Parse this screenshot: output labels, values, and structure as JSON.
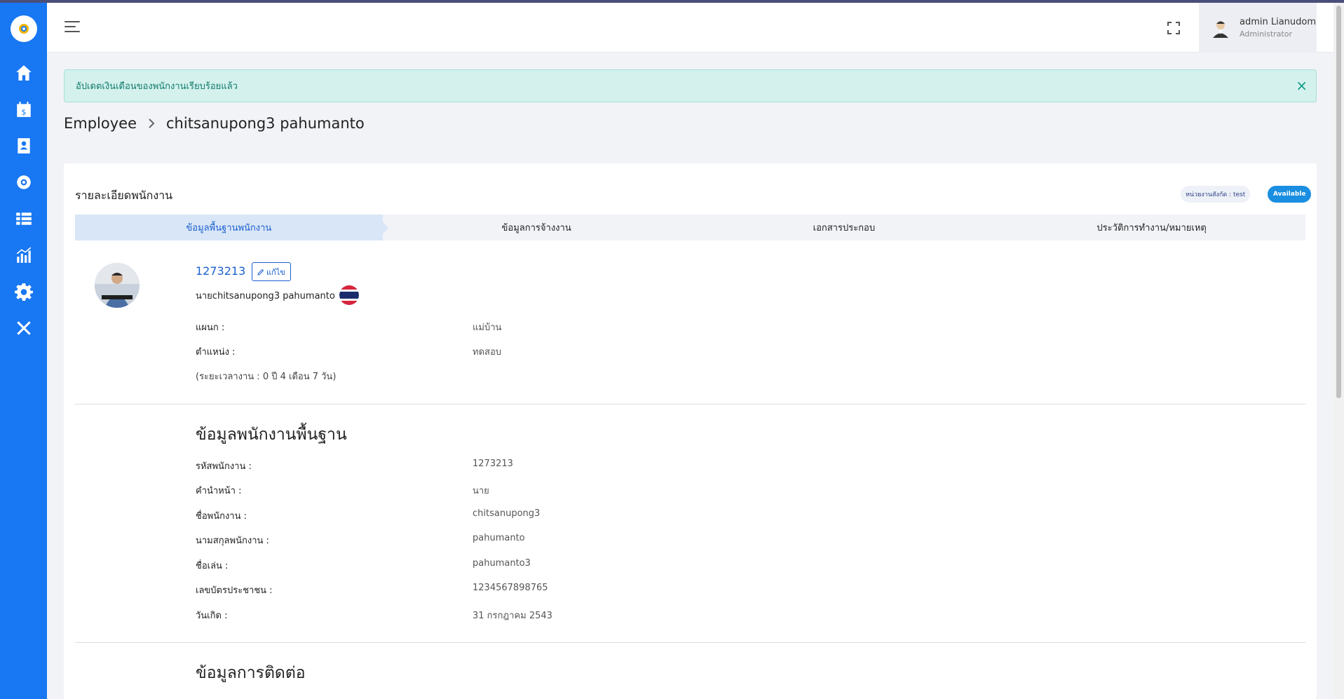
{
  "header": {
    "user_name": "admin Lianudom",
    "user_role": "Administrator"
  },
  "alert": {
    "message": "อัปเดตเงินเดือนของพนักงานเรียบร้อยแล้ว",
    "close": "×"
  },
  "breadcrumb": {
    "parent": "Employee",
    "current": "chitsanupong3 pahumanto"
  },
  "card": {
    "title": "รายละเอียดพนักงาน",
    "dept_tag": "หน่วยงานสังกัด : test",
    "status_tag": "Available"
  },
  "tabs": [
    {
      "label": "ข้อมูลพื้นฐานพนักงาน"
    },
    {
      "label": "ข้อมูลการจ้างงาน"
    },
    {
      "label": "เอกสารประกอบ"
    },
    {
      "label": "ประวัติการทำงาน/หมายเหตุ"
    }
  ],
  "employee": {
    "id": "1273213",
    "edit_label": "แก้ไข",
    "full_name": "นายchitsanupong3 pahumanto",
    "department_label": "แผนก :",
    "department_value": "แม่บ้าน",
    "position_label": "ตำแหน่ง :",
    "position_value": "ทดสอบ",
    "duration": "(ระยะเวลางาน : 0 ปี 4 เดือน 7 วัน)"
  },
  "basic_info": {
    "title": "ข้อมูลพนักงานพื้นฐาน",
    "rows": [
      {
        "label": "รหัสพนักงาน :",
        "value": "1273213"
      },
      {
        "label": "คำนำหน้า :",
        "value": "นาย"
      },
      {
        "label": "ชื่อพนักงาน :",
        "value": "chitsanupong3"
      },
      {
        "label": "นามสกุลพนักงาน :",
        "value": "pahumanto"
      },
      {
        "label": "ชื่อเล่น :",
        "value": "pahumanto3"
      },
      {
        "label": "เลขบัตรประชาชน :",
        "value": "1234567898765"
      },
      {
        "label": "วันเกิด :",
        "value": "31 กรกฎาคม 2543"
      }
    ]
  },
  "contact_info": {
    "title": "ข้อมูลการติดต่อ"
  },
  "colors": {
    "sidebar": "#1877f2",
    "accent": "#1b5fcf",
    "alert_bg": "#d4f1ed",
    "status": "#1a8ee0"
  }
}
